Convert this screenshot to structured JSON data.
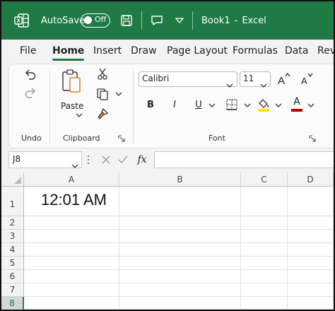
{
  "titlebar": {
    "autosave_label": "AutoSave",
    "autosave_state": "Off",
    "title": "Book1",
    "separator": "-",
    "app_name": "Excel"
  },
  "menu": [
    "File",
    "Home",
    "Insert",
    "Draw",
    "Page Layout",
    "Formulas",
    "Data",
    "Rev"
  ],
  "ribbon": {
    "undo_group": "Undo",
    "clipboard_group": "Clipboard",
    "paste_label": "Paste",
    "font_group": "Font",
    "font_name": "Calibri",
    "font_size": "11",
    "bold": "B",
    "italic": "I",
    "underline": "U",
    "font_color_letter": "A",
    "highlight_color": "#ffe600",
    "font_color": "#c00000"
  },
  "formula": {
    "name_box": "J8",
    "fx": "fx",
    "value": ""
  },
  "sheet": {
    "columns": [
      "A",
      "B",
      "C",
      "D"
    ],
    "rows": [
      "1",
      "2",
      "3",
      "4",
      "5",
      "6",
      "7",
      "8"
    ],
    "cell_a1": "12:01 AM"
  },
  "colors": {
    "brand": "#1f7a45"
  }
}
